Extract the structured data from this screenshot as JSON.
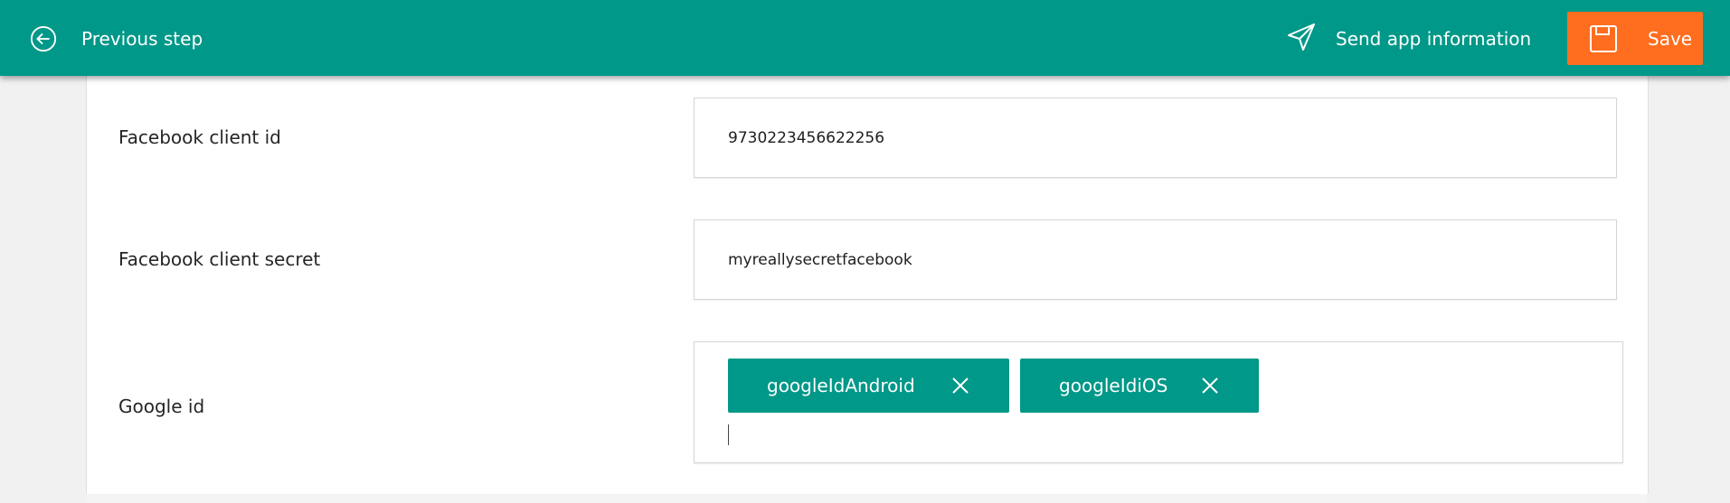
{
  "topbar": {
    "previous_label": "Previous step",
    "send_label": "Send app information",
    "save_label": "Save",
    "colors": {
      "background": "#009888",
      "save": "#ff6d1f"
    },
    "icons": {
      "previous": "back-arrow-circle-icon",
      "send": "paper-plane-icon",
      "save": "floppy-disk-icon"
    }
  },
  "form": {
    "facebook_client_id": {
      "label": "Facebook client id",
      "value": "9730223456622256"
    },
    "facebook_client_secret": {
      "label": "Facebook client secret",
      "value": "myreallysecretfacebook"
    },
    "google_id": {
      "label": "Google id",
      "tags": [
        "googleIdAndroid",
        "googleIdiOS"
      ],
      "input_value": ""
    }
  }
}
